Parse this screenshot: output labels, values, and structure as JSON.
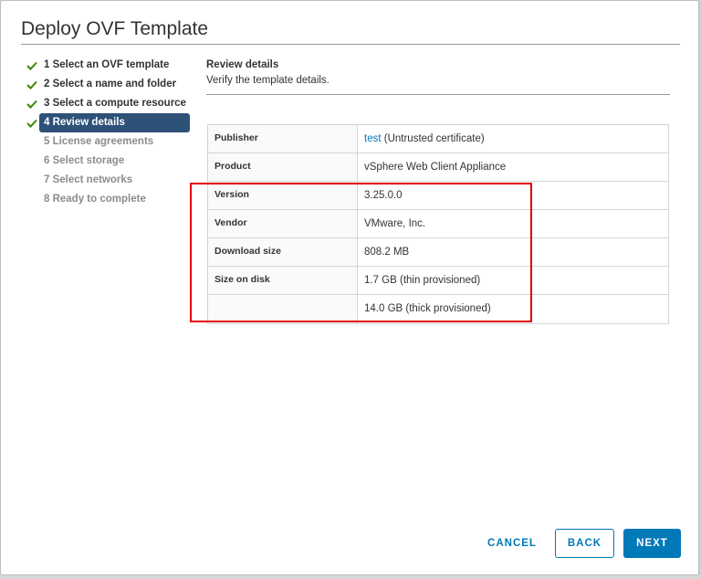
{
  "dialog": {
    "title": "Deploy OVF Template"
  },
  "steps": [
    {
      "label": "1 Select an OVF template",
      "state": "done"
    },
    {
      "label": "2 Select a name and folder",
      "state": "done"
    },
    {
      "label": "3 Select a compute resource",
      "state": "done"
    },
    {
      "label": "4 Review details",
      "state": "active"
    },
    {
      "label": "5 License agreements",
      "state": "todo"
    },
    {
      "label": "6 Select storage",
      "state": "todo"
    },
    {
      "label": "7 Select networks",
      "state": "todo"
    },
    {
      "label": "8 Ready to complete",
      "state": "todo"
    }
  ],
  "content": {
    "title": "Review details",
    "subtitle": "Verify the template details."
  },
  "details": {
    "publisher_label": "Publisher",
    "publisher_link": "test",
    "publisher_note": " (Untrusted certificate)",
    "product_label": "Product",
    "product_value": "vSphere Web Client Appliance",
    "version_label": "Version",
    "version_value": "3.25.0.0",
    "vendor_label": "Vendor",
    "vendor_value": "VMware, Inc.",
    "download_label": "Download size",
    "download_value": "808.2 MB",
    "disk_label": "Size on disk",
    "disk_thin": "1.7 GB (thin provisioned)",
    "disk_thick": "14.0 GB (thick provisioned)"
  },
  "buttons": {
    "cancel": "CANCEL",
    "back": "BACK",
    "next": "NEXT"
  },
  "colors": {
    "accent": "#0079b8",
    "active_step": "#2e5178",
    "check": "#3c8500",
    "highlight": "#e00000"
  }
}
